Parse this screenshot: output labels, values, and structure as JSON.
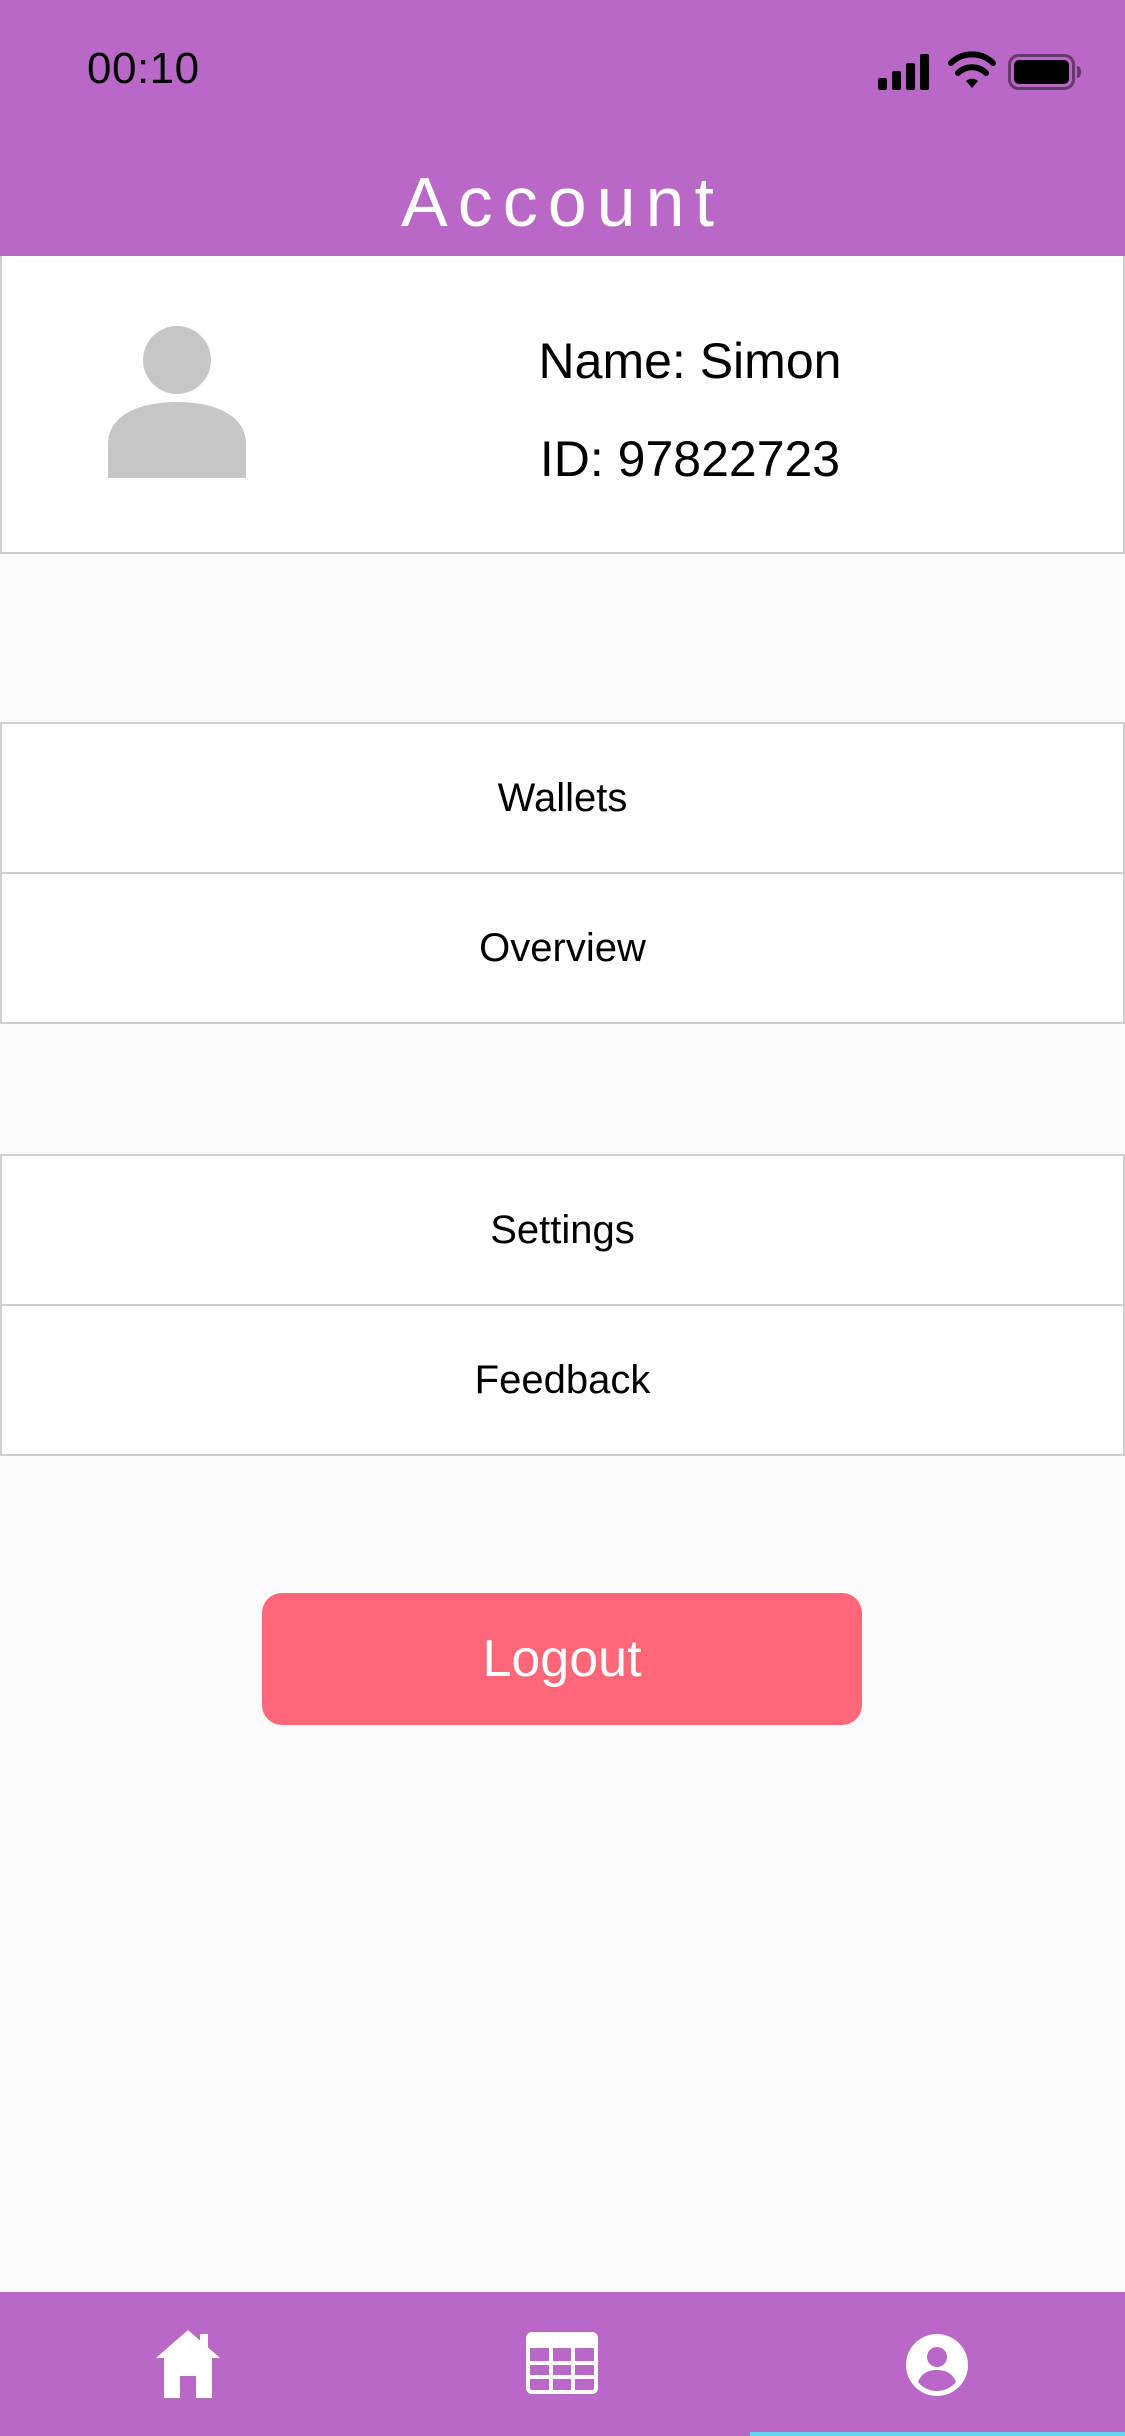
{
  "status_bar": {
    "time": "00:10",
    "icons": [
      "signal-icon",
      "wifi-icon",
      "battery-icon"
    ]
  },
  "header": {
    "title": "Account"
  },
  "profile": {
    "avatar_icon": "person-icon",
    "name_text": "Name: Simon",
    "id_text": "ID: 97822723"
  },
  "menu": {
    "group1": [
      {
        "label": "Wallets"
      },
      {
        "label": "Overview"
      }
    ],
    "group2": [
      {
        "label": "Settings"
      },
      {
        "label": "Feedback"
      }
    ]
  },
  "logout": {
    "label": "Logout"
  },
  "tabbar": {
    "tabs": [
      {
        "icon": "home-icon",
        "active": false
      },
      {
        "icon": "table-icon",
        "active": false
      },
      {
        "icon": "account-circle-icon",
        "active": true
      }
    ]
  },
  "colors": {
    "brand": "#b968c7",
    "logout": "#ff6678",
    "background": "#fafafa",
    "avatar": "#c6c6c6",
    "active_indicator": "#5fd7f0"
  }
}
